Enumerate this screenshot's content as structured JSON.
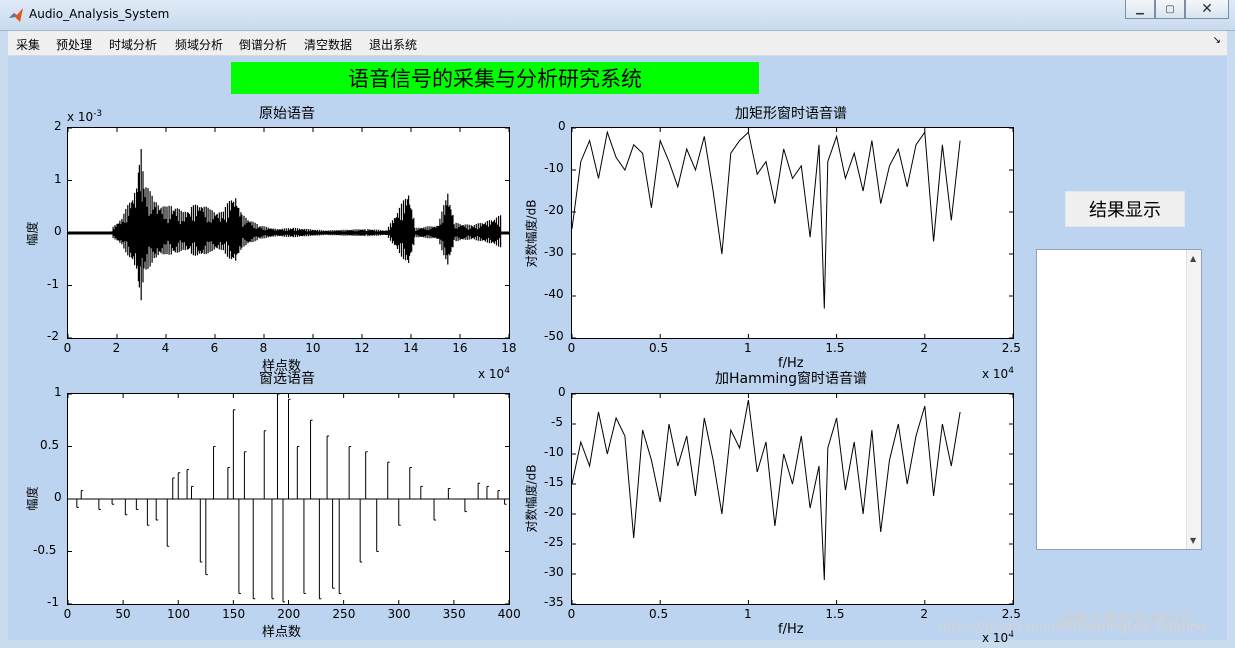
{
  "window": {
    "title": "Audio_Analysis_System",
    "min_icon": "minimize-icon",
    "max_icon": "maximize-icon",
    "close_icon": "close-icon",
    "app_icon": "matlab-icon"
  },
  "menu": {
    "items": [
      "采集",
      "预处理",
      "时域分析",
      "频域分析",
      "倒谱分析",
      "清空数据",
      "退出系统"
    ],
    "corner_glyph": "↘"
  },
  "banner": {
    "text": "语音信号的采集与分析研究系统",
    "color": "#00ff00"
  },
  "result_button": {
    "label": "结果显示"
  },
  "watermark": {
    "line1": "@稀土掘金技术社区",
    "line2": "https://blog.csdn.net/SoaringLee_fighting"
  },
  "chart_data": [
    {
      "type": "line",
      "title": "原始语音",
      "xlabel": "样点数",
      "ylabel": "幅度",
      "x_exponent": "x 10",
      "x_exponent_power": "4",
      "y_exponent": "x 10",
      "y_exponent_power": "-3",
      "xlim": [
        0,
        18
      ],
      "ylim": [
        -2,
        2
      ],
      "xticks": [
        "0",
        "2",
        "4",
        "6",
        "8",
        "10",
        "12",
        "14",
        "16",
        "18"
      ],
      "yticks": [
        "2",
        "1",
        "0",
        "-1",
        "-2"
      ],
      "envelope": [
        {
          "x": 1.8,
          "amp": 0.1
        },
        {
          "x": 2.2,
          "amp": 0.3
        },
        {
          "x": 2.8,
          "amp": 0.9
        },
        {
          "x": 2.95,
          "amp": 1.8
        },
        {
          "x": 3.1,
          "amp": 1.0
        },
        {
          "x": 3.6,
          "amp": 0.6
        },
        {
          "x": 4.0,
          "amp": 0.5
        },
        {
          "x": 4.3,
          "amp": 0.55
        },
        {
          "x": 4.7,
          "amp": 0.4
        },
        {
          "x": 5.0,
          "amp": 0.5
        },
        {
          "x": 5.4,
          "amp": 0.6
        },
        {
          "x": 5.8,
          "amp": 0.45
        },
        {
          "x": 6.3,
          "amp": 0.4
        },
        {
          "x": 6.8,
          "amp": 0.8
        },
        {
          "x": 7.1,
          "amp": 0.35
        },
        {
          "x": 7.8,
          "amp": 0.15
        },
        {
          "x": 8.5,
          "amp": 0.08
        },
        {
          "x": 9.2,
          "amp": 0.1
        },
        {
          "x": 10.5,
          "amp": 0.05
        },
        {
          "x": 12.2,
          "amp": 0.08
        },
        {
          "x": 13.0,
          "amp": 0.05
        },
        {
          "x": 13.9,
          "amp": 0.8
        },
        {
          "x": 14.2,
          "amp": 0.1
        },
        {
          "x": 15.1,
          "amp": 0.15
        },
        {
          "x": 15.5,
          "amp": 0.8
        },
        {
          "x": 15.8,
          "amp": 0.2
        },
        {
          "x": 16.5,
          "amp": 0.15
        },
        {
          "x": 17.2,
          "amp": 0.25
        },
        {
          "x": 17.7,
          "amp": 0.35
        }
      ]
    },
    {
      "type": "line",
      "title": "加矩形窗时语音谱",
      "xlabel": "f/Hz",
      "ylabel": "对数幅度/dB",
      "x_exponent": "x 10",
      "x_exponent_power": "4",
      "xlim": [
        0,
        2.5
      ],
      "ylim": [
        -50,
        0
      ],
      "xticks": [
        "0",
        "0.5",
        "1",
        "1.5",
        "2",
        "2.5"
      ],
      "yticks": [
        "0",
        "-10",
        "-20",
        "-30",
        "-40",
        "-50"
      ],
      "x": [
        0,
        0.05,
        0.1,
        0.15,
        0.2,
        0.25,
        0.3,
        0.35,
        0.4,
        0.45,
        0.5,
        0.55,
        0.6,
        0.65,
        0.7,
        0.75,
        0.8,
        0.85,
        0.9,
        0.95,
        1.0,
        1.05,
        1.1,
        1.15,
        1.2,
        1.25,
        1.3,
        1.35,
        1.4,
        1.43,
        1.45,
        1.5,
        1.55,
        1.6,
        1.65,
        1.7,
        1.75,
        1.8,
        1.85,
        1.9,
        1.95,
        2.0,
        2.05,
        2.1,
        2.15,
        2.2
      ],
      "values": [
        -24,
        -8,
        -3,
        -12,
        -1,
        -7,
        -10,
        -4,
        -6,
        -19,
        -3,
        -8,
        -14,
        -5,
        -10,
        -2,
        -15,
        -30,
        -6,
        -3,
        -1,
        -11,
        -8,
        -18,
        -5,
        -12,
        -9,
        -26,
        -4,
        -43,
        -8,
        -2,
        -12,
        -6,
        -15,
        -3,
        -18,
        -9,
        -5,
        -14,
        -4,
        -1,
        -27,
        -4,
        -22,
        -3
      ]
    },
    {
      "type": "line",
      "title": "窗选语音",
      "xlabel": "样点数",
      "ylabel": "幅度",
      "xlim": [
        0,
        400
      ],
      "ylim": [
        -1,
        1
      ],
      "xticks": [
        "0",
        "50",
        "100",
        "150",
        "200",
        "250",
        "300",
        "350",
        "400"
      ],
      "yticks": [
        "1",
        "0.5",
        "0",
        "-0.5",
        "-1"
      ],
      "spikes": [
        {
          "x": 8,
          "v": -0.08
        },
        {
          "x": 12,
          "v": 0.08
        },
        {
          "x": 28,
          "v": -0.1
        },
        {
          "x": 40,
          "v": -0.05
        },
        {
          "x": 52,
          "v": -0.15
        },
        {
          "x": 62,
          "v": -0.1
        },
        {
          "x": 72,
          "v": -0.25
        },
        {
          "x": 80,
          "v": -0.2
        },
        {
          "x": 90,
          "v": -0.45
        },
        {
          "x": 95,
          "v": 0.2
        },
        {
          "x": 100,
          "v": 0.25
        },
        {
          "x": 108,
          "v": 0.28
        },
        {
          "x": 112,
          "v": 0.12
        },
        {
          "x": 120,
          "v": -0.6
        },
        {
          "x": 125,
          "v": -0.72
        },
        {
          "x": 132,
          "v": 0.5
        },
        {
          "x": 145,
          "v": 0.3
        },
        {
          "x": 150,
          "v": 0.85
        },
        {
          "x": 155,
          "v": -0.9
        },
        {
          "x": 160,
          "v": 0.45
        },
        {
          "x": 168,
          "v": -0.95
        },
        {
          "x": 178,
          "v": 0.65
        },
        {
          "x": 185,
          "v": -0.95
        },
        {
          "x": 190,
          "v": 1.0
        },
        {
          "x": 195,
          "v": -0.98
        },
        {
          "x": 200,
          "v": 0.95
        },
        {
          "x": 208,
          "v": 0.5
        },
        {
          "x": 214,
          "v": -0.9
        },
        {
          "x": 220,
          "v": 0.75
        },
        {
          "x": 228,
          "v": -0.95
        },
        {
          "x": 235,
          "v": 0.6
        },
        {
          "x": 240,
          "v": -0.85
        },
        {
          "x": 246,
          "v": -0.9
        },
        {
          "x": 255,
          "v": 0.5
        },
        {
          "x": 265,
          "v": -0.6
        },
        {
          "x": 270,
          "v": 0.45
        },
        {
          "x": 280,
          "v": -0.5
        },
        {
          "x": 290,
          "v": 0.35
        },
        {
          "x": 300,
          "v": -0.25
        },
        {
          "x": 310,
          "v": 0.3
        },
        {
          "x": 320,
          "v": 0.12
        },
        {
          "x": 332,
          "v": -0.2
        },
        {
          "x": 345,
          "v": 0.1
        },
        {
          "x": 360,
          "v": -0.12
        },
        {
          "x": 372,
          "v": 0.15
        },
        {
          "x": 380,
          "v": 0.12
        },
        {
          "x": 390,
          "v": 0.08
        },
        {
          "x": 396,
          "v": -0.05
        }
      ]
    },
    {
      "type": "line",
      "title": "加Hamming窗时语音谱",
      "xlabel": "f/Hz",
      "ylabel": "对数幅度/dB",
      "x_exponent": "x 10",
      "x_exponent_power": "4",
      "xlim": [
        0,
        2.5
      ],
      "ylim": [
        -35,
        0
      ],
      "xticks": [
        "0",
        "0.5",
        "1",
        "1.5",
        "2",
        "2.5"
      ],
      "yticks": [
        "0",
        "-5",
        "-10",
        "-15",
        "-20",
        "-25",
        "-30",
        "-35"
      ],
      "x": [
        0,
        0.05,
        0.1,
        0.15,
        0.2,
        0.25,
        0.3,
        0.35,
        0.4,
        0.45,
        0.5,
        0.55,
        0.6,
        0.65,
        0.7,
        0.75,
        0.8,
        0.85,
        0.9,
        0.95,
        1.0,
        1.05,
        1.1,
        1.15,
        1.2,
        1.25,
        1.3,
        1.35,
        1.4,
        1.43,
        1.45,
        1.5,
        1.55,
        1.6,
        1.65,
        1.7,
        1.75,
        1.8,
        1.85,
        1.9,
        1.95,
        2.0,
        2.05,
        2.1,
        2.15,
        2.2
      ],
      "values": [
        -15,
        -8,
        -12,
        -3,
        -10,
        -4,
        -7,
        -24,
        -6,
        -11,
        -18,
        -5,
        -12,
        -7,
        -17,
        -4,
        -11,
        -20,
        -6,
        -9,
        -1,
        -13,
        -8,
        -22,
        -10,
        -15,
        -7,
        -19,
        -12,
        -31,
        -9,
        -4,
        -16,
        -8,
        -20,
        -6,
        -23,
        -11,
        -5,
        -15,
        -7,
        -2,
        -17,
        -5,
        -12,
        -3
      ]
    }
  ]
}
